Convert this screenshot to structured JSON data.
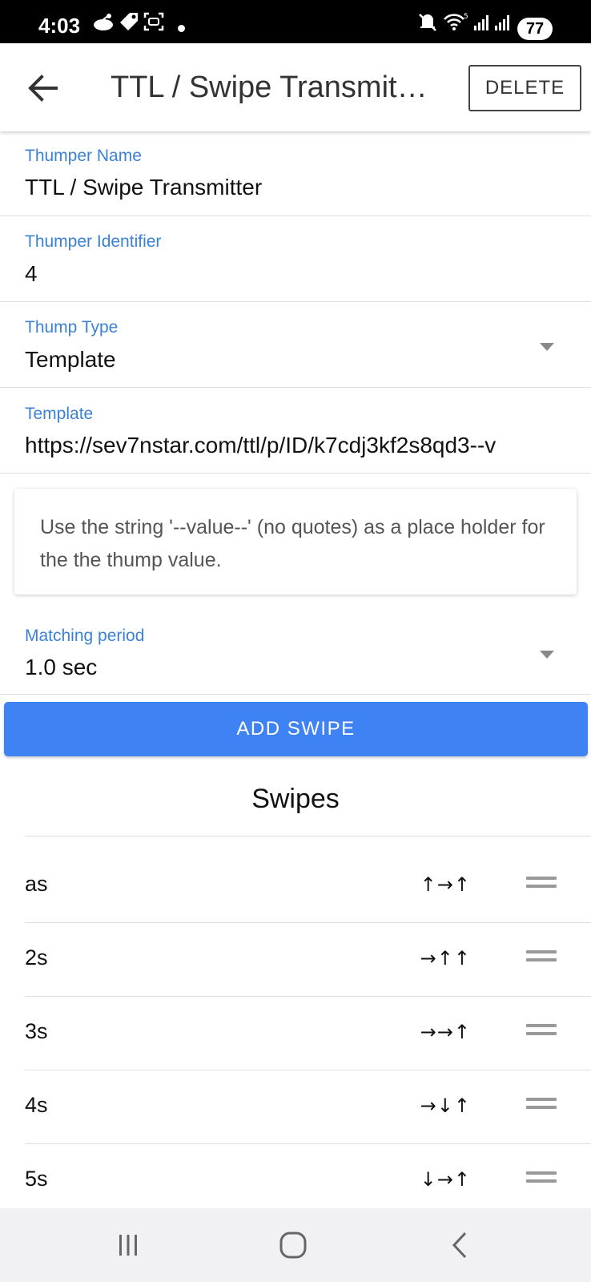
{
  "status_bar": {
    "time": "4:03",
    "battery": "77"
  },
  "app_bar": {
    "title": "TTL / Swipe Transmitter",
    "delete_label": "DELETE"
  },
  "form": {
    "thumper_name": {
      "label": "Thumper Name",
      "value": "TTL / Swipe Transmitter"
    },
    "thumper_identifier": {
      "label": "Thumper Identifier",
      "value": "4"
    },
    "thump_type": {
      "label": "Thump Type",
      "value": "Template"
    },
    "template": {
      "label": "Template",
      "value": "https://sev7nstar.com/ttl/p/ID/k7cdj3kf2s8qd3--v"
    },
    "info_text": "Use the string '--value--' (no quotes) as a place holder for the the thump value.",
    "matching_period": {
      "label": "Matching period",
      "value": "1.0 sec"
    }
  },
  "add_swipe_label": "ADD SWIPE",
  "swipes_title": "Swipes",
  "swipes": [
    {
      "name": "as",
      "pattern": "↑→↑"
    },
    {
      "name": "2s",
      "pattern": "→↑↑"
    },
    {
      "name": "3s",
      "pattern": "→→↑"
    },
    {
      "name": "4s",
      "pattern": "→↓↑"
    },
    {
      "name": "5s",
      "pattern": "↓→↑"
    }
  ],
  "colors": {
    "accent": "#3f82f4",
    "label_blue": "#3b82d6"
  }
}
